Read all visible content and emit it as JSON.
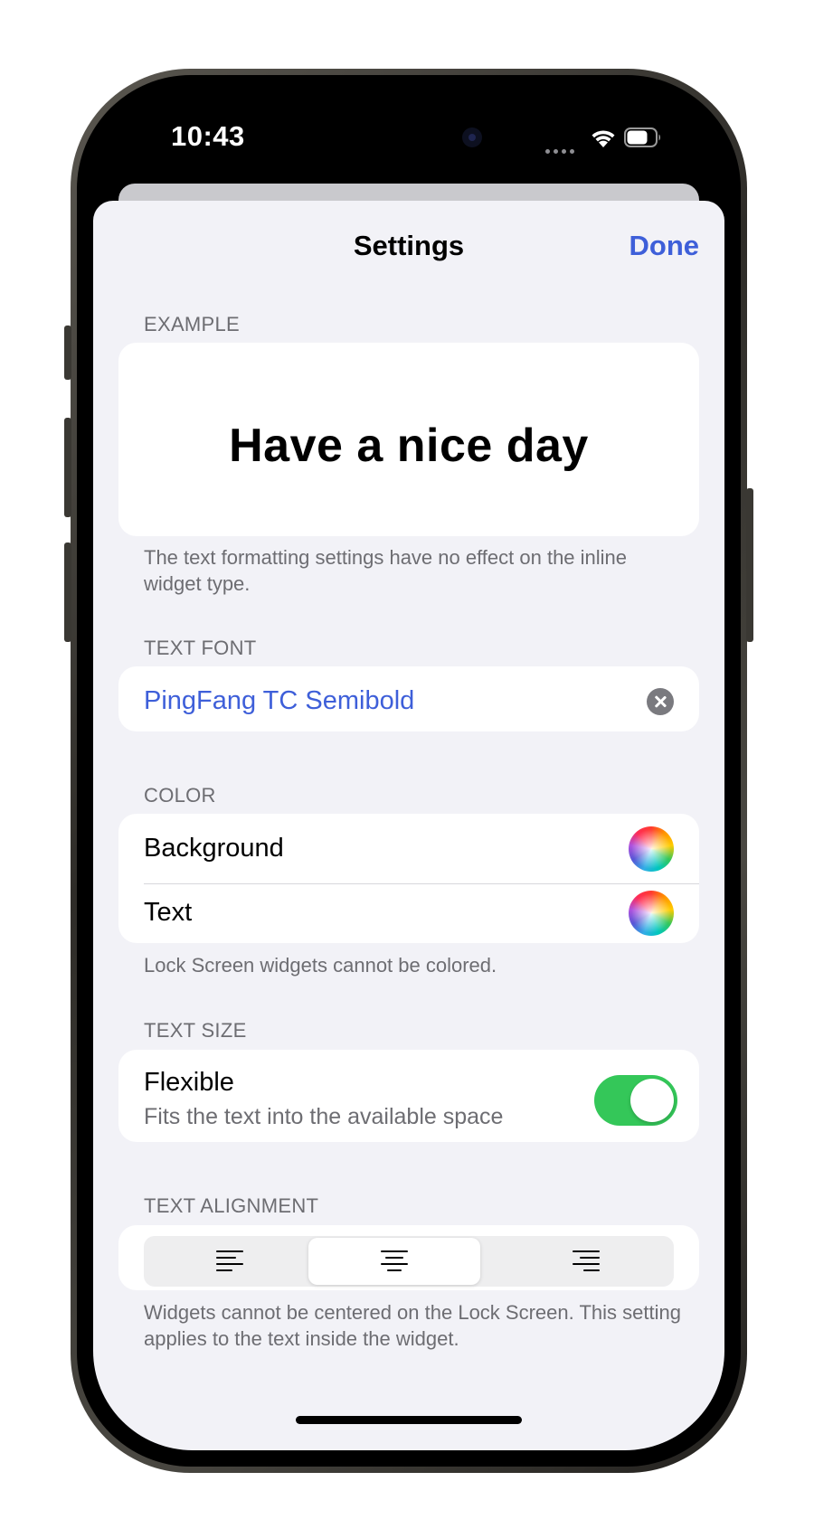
{
  "status_bar": {
    "time": "10:43",
    "wifi_icon": "wifi-icon",
    "battery_icon": "battery-icon"
  },
  "nav": {
    "title": "Settings",
    "done_label": "Done"
  },
  "example": {
    "header": "EXAMPLE",
    "text": "Have a nice day",
    "footer": "The text formatting settings have no effect on the inline widget type."
  },
  "text_font": {
    "header": "TEXT FONT",
    "value": "PingFang TC Semibold",
    "clear_icon": "xmark-circle-icon"
  },
  "color": {
    "header": "COLOR",
    "rows": [
      {
        "label": "Background",
        "icon": "color-wheel-icon"
      },
      {
        "label": "Text",
        "icon": "color-wheel-icon"
      }
    ],
    "footer": "Lock Screen widgets cannot be colored."
  },
  "text_size": {
    "header": "TEXT SIZE",
    "title": "Flexible",
    "subtitle": "Fits the text into the available space",
    "toggle_on": true
  },
  "text_alignment": {
    "header": "TEXT ALIGNMENT",
    "options": [
      "align-left-icon",
      "align-center-icon",
      "align-right-icon"
    ],
    "selected_index": 1,
    "footer": "Widgets cannot be centered on the Lock Screen. This setting applies to the text inside the widget."
  },
  "colors": {
    "accent": "#3e5fd9",
    "toggle_on": "#34c759",
    "background": "#f2f2f7",
    "secondary_text": "#6d6d72"
  }
}
